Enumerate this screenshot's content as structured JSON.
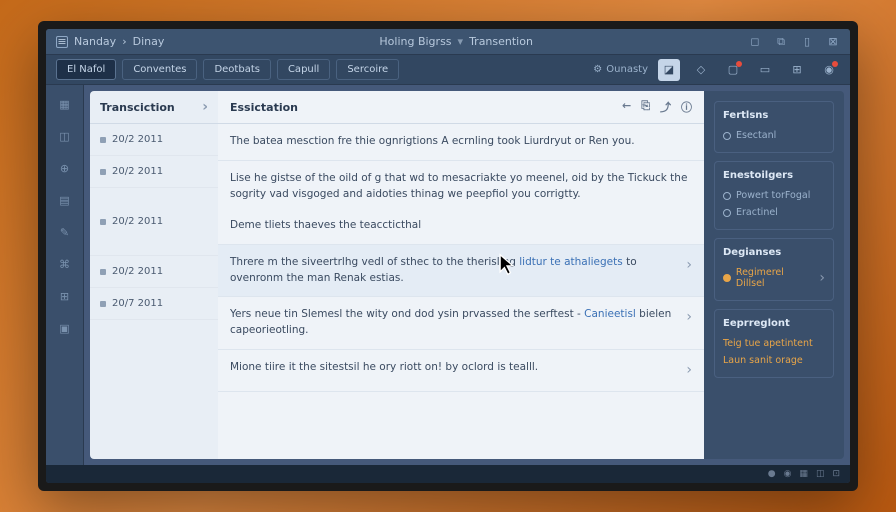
{
  "breadcrumb": {
    "item1": "Nanday",
    "item2": "Dinay"
  },
  "header": {
    "title": "Holing Bigrss",
    "subtitle": "Transention"
  },
  "toolbar": {
    "tab_main": "El Nafol",
    "tab_conv": "Conventes",
    "tab_dept": "Deotbats",
    "tab_cap": "Capull",
    "tab_sec": "Sercoire",
    "right_label": "Ounasty"
  },
  "tcol": {
    "header": "Transciction",
    "rows": [
      "20/2 2011",
      "20/2 2011",
      "20/2 2011",
      "20/2 2011",
      "20/7 2011"
    ]
  },
  "dcol": {
    "header": "Essictation",
    "entries": [
      {
        "text": "The batea mesction fre thie ognrigtions A ecrnling took Liurdryut or Ren you."
      },
      {
        "text": "Lise he gistse of the oild of g that wd to mesacriakte yo meenel, oid by the Tickuck the sogrity vad visgoged and aidoties thinag we peepfiol you corrigtty."
      },
      {
        "text": "Deme tliets thaeves the teaccticthal"
      },
      {
        "text": "Threre m the siveertrlhg vedl of sthec to the therisling ",
        "link1": "lidtur te athaliegets",
        "text2": " to ovenronm the man Renak estias."
      },
      {
        "text": "Yers neue tin Slemesl the wity ond dod ysin prvassed the serftest - ",
        "link1": "Canieetisl",
        "text2": " bielen capeorieotling."
      },
      {
        "text": "Mione tiire it the sitestsil he ory riott on! by oclord is tealll."
      }
    ]
  },
  "side": {
    "sec1_h": "Fertlsns",
    "sec1_i1": "Esectanl",
    "sec2_h": "Enestoilgers",
    "sec2_i1": "Powert torFogal",
    "sec2_i2": "Eractinel",
    "sec3_h": "Degianses",
    "sec3_i1": "Regimerel Dillsel",
    "sec4_h": "Eeprreglont",
    "sec4_i1": "Teig tue apetintent",
    "sec4_i2": "Laun sanit orage"
  }
}
